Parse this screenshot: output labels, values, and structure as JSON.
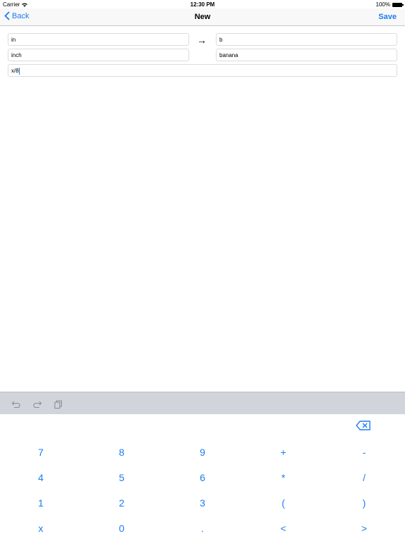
{
  "status": {
    "carrier": "Carrier",
    "time": "12:30 PM",
    "battery": "100%"
  },
  "nav": {
    "back_label": "Back",
    "title": "New",
    "save_label": "Save"
  },
  "form": {
    "from_unit_short": "in",
    "from_unit_name": "inch",
    "to_unit_short": "b",
    "to_unit_name": "banana",
    "formula": "x/8",
    "arrow": "→"
  },
  "keypad": {
    "rows": [
      [
        "7",
        "8",
        "9",
        "+",
        "-"
      ],
      [
        "4",
        "5",
        "6",
        "*",
        "/"
      ],
      [
        "1",
        "2",
        "3",
        "(",
        ")"
      ],
      [
        "x",
        "0",
        ".",
        "<",
        ">"
      ]
    ]
  },
  "icons": {
    "back": "chevron-left-icon",
    "undo": "undo-icon",
    "redo": "redo-icon",
    "paste": "paste-icon",
    "backspace": "backspace-icon"
  },
  "colors": {
    "accent": "#1a7cf0",
    "toolbar_bg": "#d1d5db"
  }
}
